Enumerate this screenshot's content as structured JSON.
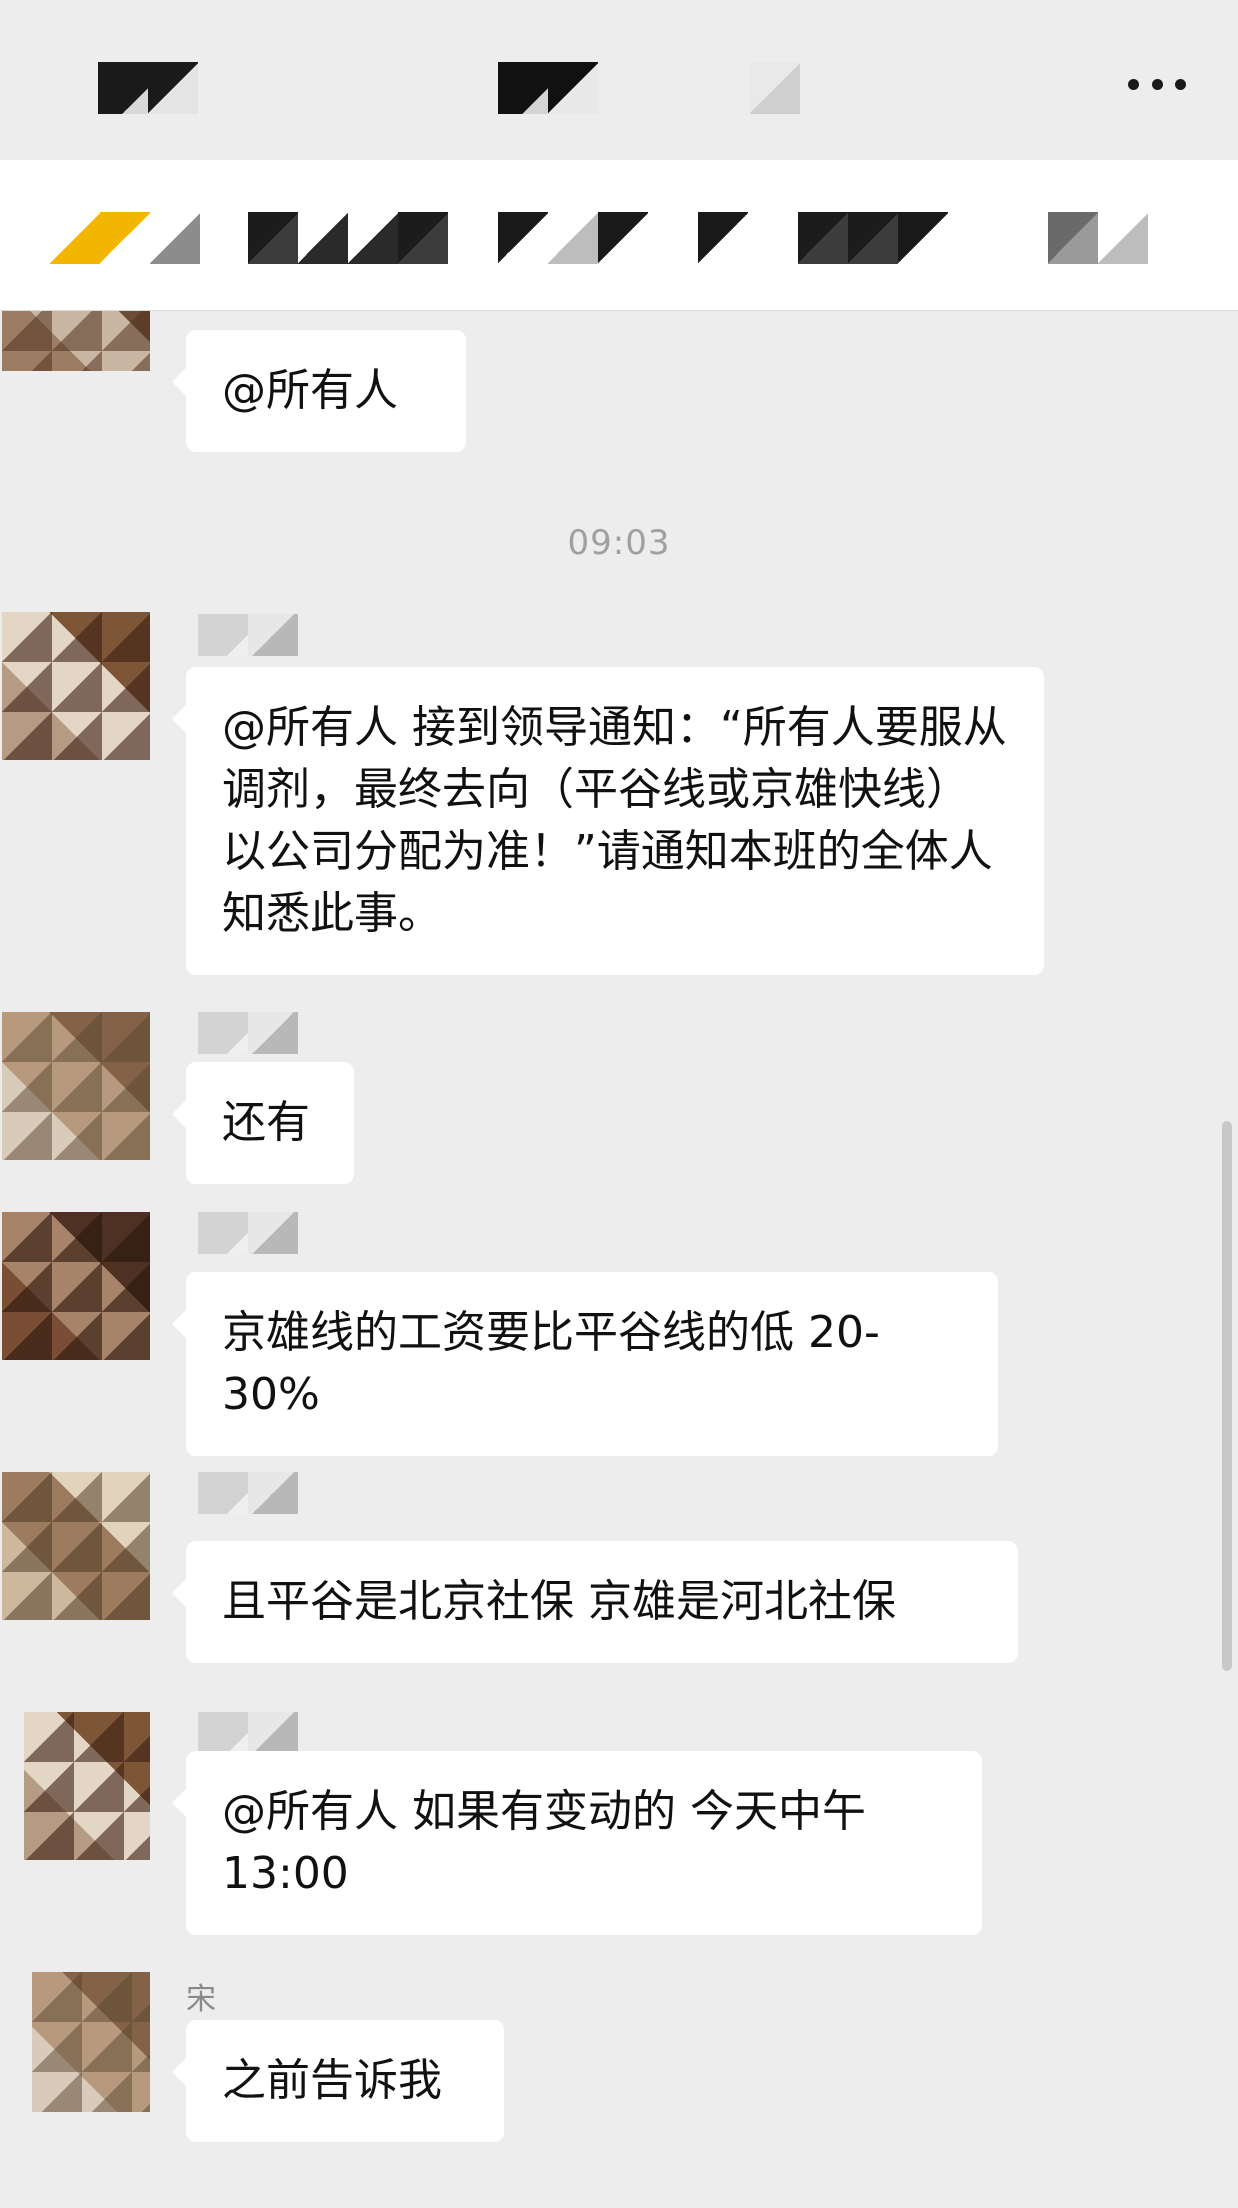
{
  "header": {
    "more_icon": "more-icon"
  },
  "chat": {
    "timestamp": "09:03",
    "messages": [
      {
        "text": "@所有人"
      },
      {
        "text": "@所有人 接到领导通知：“所有人要服从调剂，最终去向（平谷线或京雄快线）以公司分配为准！”请通知本班的全体人知悉此事。"
      },
      {
        "text": "还有"
      },
      {
        "text": "京雄线的工资要比平谷线的低 20-30%"
      },
      {
        "text": "且平谷是北京社保 京雄是河北社保"
      },
      {
        "text": "@所有人 如果有变动的 今天中午 13:00"
      },
      {
        "nickname": "宋",
        "text": "之前告诉我"
      }
    ]
  },
  "colors": {
    "background": "#ededed",
    "bubble": "#ffffff",
    "timestamp": "#a0a0a0"
  }
}
